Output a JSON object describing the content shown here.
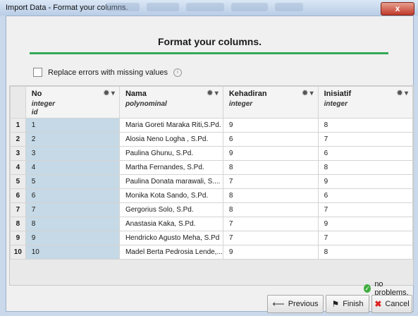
{
  "window": {
    "title": "Import Data - Format your columns.",
    "close_label": "x"
  },
  "page": {
    "heading": "Format your columns.",
    "replace_errors_label": "Replace errors with missing values",
    "info_icon": "info-icon"
  },
  "columns": [
    {
      "name": "No",
      "type": "integer",
      "role": "id"
    },
    {
      "name": "Nama",
      "type": "polynominal",
      "role": ""
    },
    {
      "name": "Kehadiran",
      "type": "integer",
      "role": ""
    },
    {
      "name": "Inisiatif",
      "type": "integer",
      "role": ""
    }
  ],
  "rows": [
    {
      "n": "1",
      "no": "1",
      "nama": "Maria Goreti Maraka Riti,S.Pd.",
      "kehadiran": "9",
      "inisiatif": "8"
    },
    {
      "n": "2",
      "no": "2",
      "nama": "Alosia Neno Logha , S.Pd.",
      "kehadiran": "6",
      "inisiatif": "7"
    },
    {
      "n": "3",
      "no": "3",
      "nama": "Paulina Ghunu, S.Pd.",
      "kehadiran": "9",
      "inisiatif": "6"
    },
    {
      "n": "4",
      "no": "4",
      "nama": "Martha Fernandes, S.Pd.",
      "kehadiran": "8",
      "inisiatif": "8"
    },
    {
      "n": "5",
      "no": "5",
      "nama": "Paulina Donata marawali, S....",
      "kehadiran": "7",
      "inisiatif": "9"
    },
    {
      "n": "6",
      "no": "6",
      "nama": "Monika Kota Sando, S.Pd.",
      "kehadiran": "8",
      "inisiatif": "6"
    },
    {
      "n": "7",
      "no": "7",
      "nama": "Gergorius Solo, S.Pd.",
      "kehadiran": "8",
      "inisiatif": "7"
    },
    {
      "n": "8",
      "no": "8",
      "nama": "Anastasia Kaka, S.Pd.",
      "kehadiran": "7",
      "inisiatif": "9"
    },
    {
      "n": "9",
      "no": "9",
      "nama": "Hendricko Agusto Meha, S.Pd",
      "kehadiran": "7",
      "inisiatif": "7"
    },
    {
      "n": "10",
      "no": "10",
      "nama": "Madel Berta Pedrosia Lende,...",
      "kehadiran": "9",
      "inisiatif": "8"
    }
  ],
  "footer": {
    "status_text": "no problems.",
    "previous_label": "Previous",
    "finish_label": "Finish",
    "cancel_label": "Cancel"
  },
  "colors": {
    "accent_green": "#33aa55",
    "id_column": "#c5d9e6",
    "cancel_red": "#dd2222"
  }
}
